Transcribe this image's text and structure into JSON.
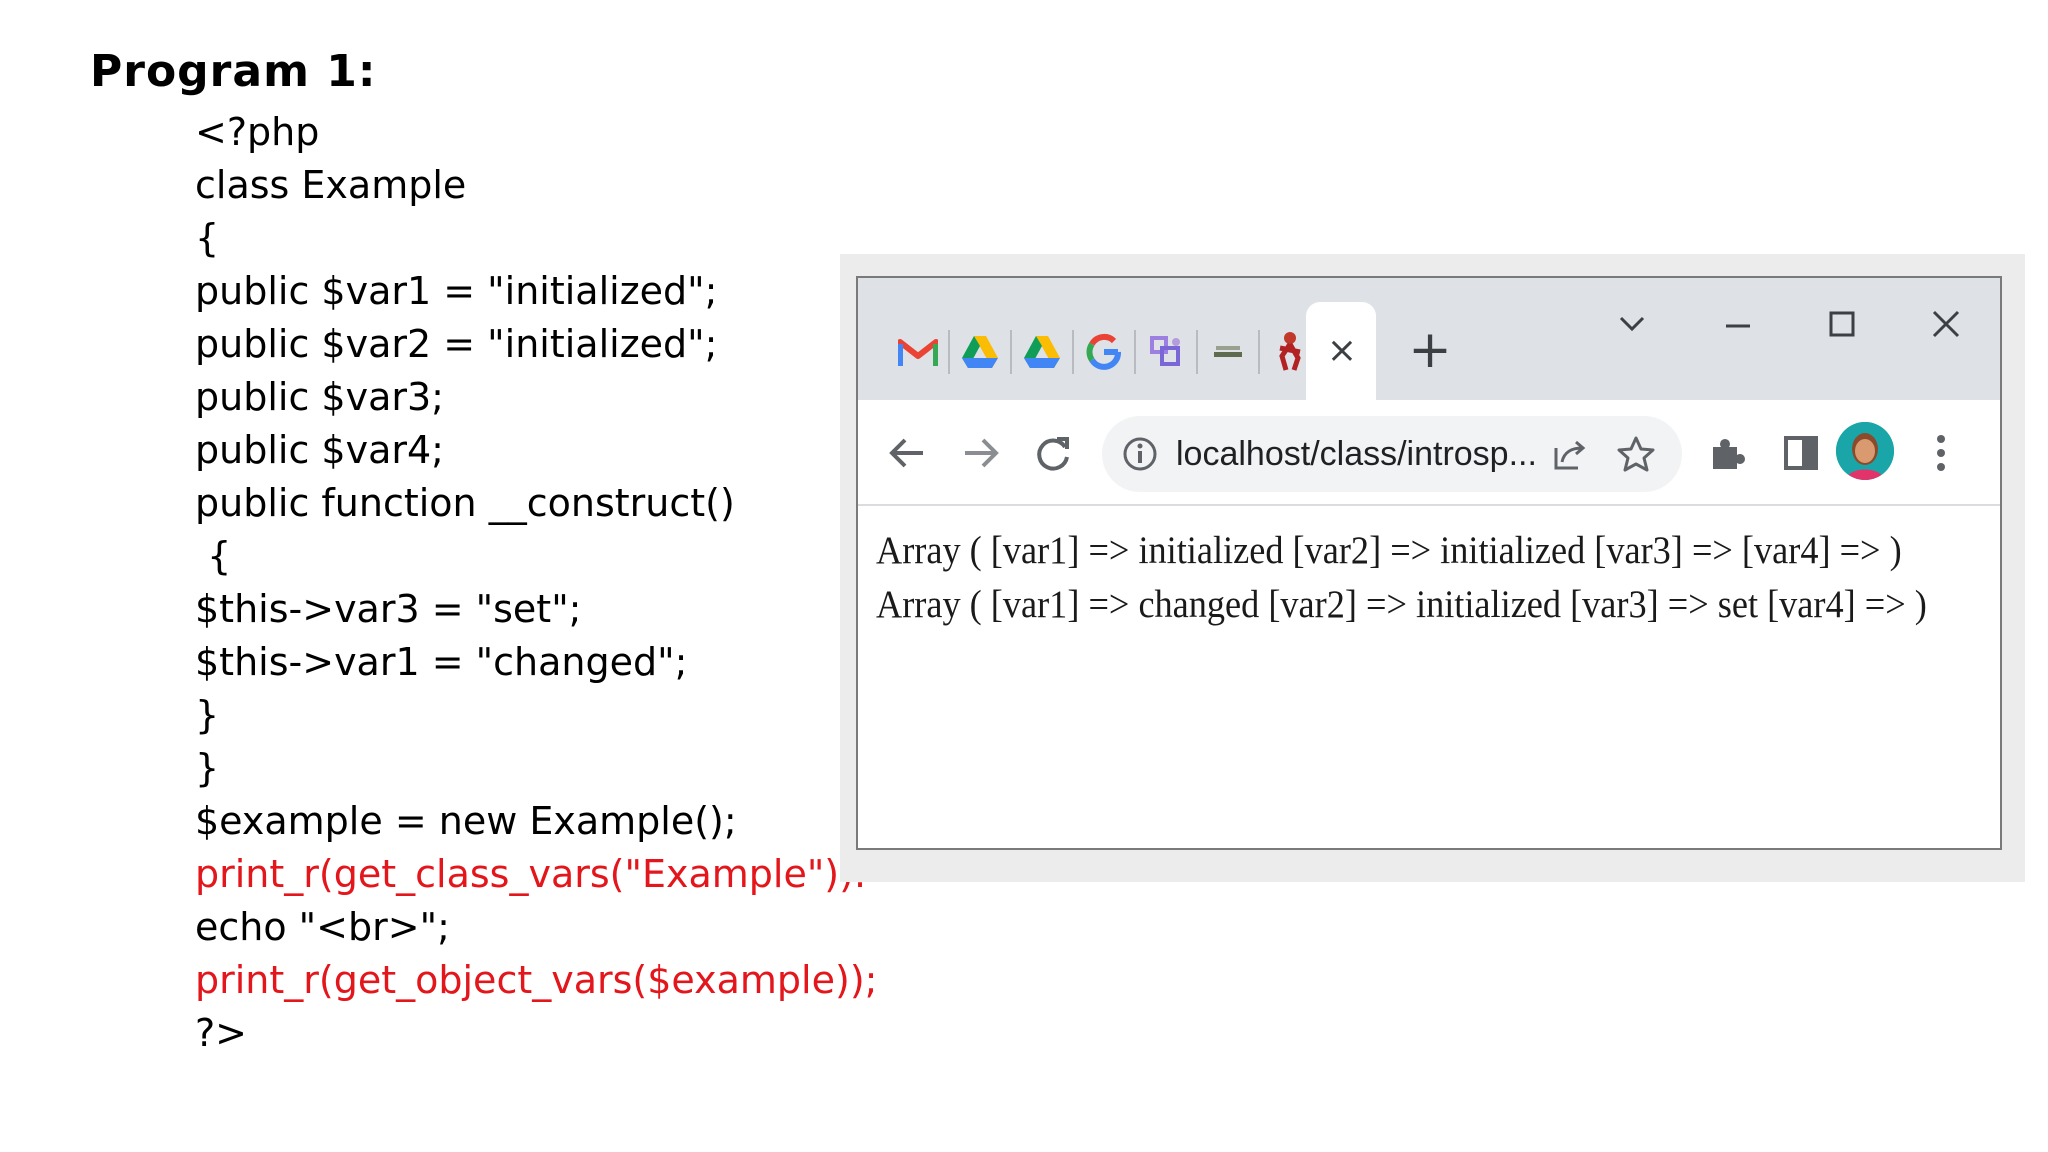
{
  "slide": {
    "title": "Program 1:"
  },
  "code": {
    "lines": [
      {
        "text": "<?php",
        "color": "#000000"
      },
      {
        "text": "class Example",
        "color": "#000000"
      },
      {
        "text": "{",
        "color": "#000000"
      },
      {
        "text": "public $var1 = \"initialized\";",
        "color": "#000000"
      },
      {
        "text": "public $var2 = \"initialized\";",
        "color": "#000000"
      },
      {
        "text": "public $var3;",
        "color": "#000000"
      },
      {
        "text": "public $var4;",
        "color": "#000000"
      },
      {
        "text": "public function __construct()",
        "color": "#000000"
      },
      {
        "text": " {",
        "color": "#000000"
      },
      {
        "text": "$this->var3 = \"set\";",
        "color": "#000000"
      },
      {
        "text": "$this->var1 = \"changed\";",
        "color": "#000000"
      },
      {
        "text": "}",
        "color": "#000000"
      },
      {
        "text": "}",
        "color": "#000000"
      },
      {
        "text": "$example = new Example();",
        "color": "#000000"
      },
      {
        "text": "print_r(get_class_vars(\"Example\")).",
        "color": "#e3161c"
      },
      {
        "text": "echo \"<br>\";",
        "color": "#000000"
      },
      {
        "text": "print_r(get_object_vars($example));",
        "color": "#e3161c"
      },
      {
        "text": "?>",
        "color": "#000000"
      }
    ]
  },
  "browser": {
    "tabs": [
      {
        "icon": "gmail-icon"
      },
      {
        "icon": "google-drive-icon"
      },
      {
        "icon": "google-drive-icon"
      },
      {
        "icon": "google-icon"
      },
      {
        "icon": "puzzle-site-icon"
      },
      {
        "icon": "minimized-site-icon"
      },
      {
        "icon": "dancer-site-icon"
      }
    ],
    "active_tab_close": "×",
    "new_tab": "+",
    "url": "localhost/class/introsp...",
    "output": [
      "Array ( [var1] => initialized [var2] => initialized [var3] => [var4] => )",
      "Array ( [var1] => changed [var2] => initialized [var3] => set [var4] => )"
    ]
  }
}
